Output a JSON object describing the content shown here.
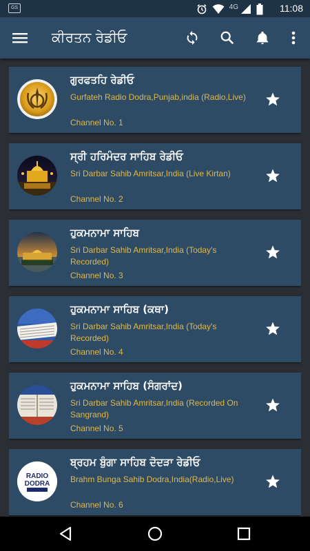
{
  "status_bar": {
    "notification_label": "GS",
    "network": "4G",
    "time": "11:08"
  },
  "app_bar": {
    "title": "ਕੀਰਤਨ ਰੇਡੀਓ",
    "actions": [
      "refresh-icon",
      "search-icon",
      "bell-icon",
      "more-vert-icon"
    ]
  },
  "channels": [
    {
      "name": "ਗੁਰਫਤਹਿ ਰੇਡੀਓ",
      "description": "Gurfateh Radio Dodra,Punjab,india (Radio,Live)",
      "channel": "Channel No. 1",
      "thumb": "khanda-logo"
    },
    {
      "name": "ਸ੍ਰੀ ਹਰਿਮੰਦਰ ਸਾਹਿਬ ਰੇਡੀਓ",
      "description": "Sri Darbar Sahib Amritsar,India (Live Kirtan)",
      "channel": "Channel No. 2",
      "thumb": "golden-temple-night"
    },
    {
      "name": "ਹੁਕਮਨਾਮਾ ਸਾਹਿਬ",
      "description": "Sri Darbar Sahib Amritsar,India (Today's Recorded)",
      "channel": "Channel No. 3",
      "thumb": "golden-temple-day"
    },
    {
      "name": "ਹੁਕਮਨਾਮਾ ਸਾਹਿਬ (ਕਥਾ)",
      "description": "Sri Darbar Sahib Amritsar,India (Today's Recorded)",
      "channel": "Channel No. 4",
      "thumb": "scripture-book"
    },
    {
      "name": "ਹੁਕਮਨਾਮਾ ਸਾਹਿਬ (ਸੰਗਰਾਂਦ)",
      "description": "Sri Darbar Sahib Amritsar,India (Recorded On Sangrand)",
      "channel": "Channel No. 5",
      "thumb": "scripture-book-2"
    },
    {
      "name": "ਬ੍ਰਹਮ ਬੁੰਗਾ ਸਾਹਿਬ ਦੋਦੜਾ ਰੇਡੀਓ",
      "description": "Brahm Bunga Sahib Dodra,India(Radio,Live)",
      "channel": "Channel No. 6",
      "thumb": "radio-dodra-logo",
      "logo_text_1": "RADIO",
      "logo_text_2": "DODRA"
    }
  ],
  "colors": {
    "app_bar": "#2e4b66",
    "card": "#2e4b66",
    "background": "#2b2f33",
    "accent_text": "#e0b84a",
    "status_bar": "#1e3346"
  }
}
